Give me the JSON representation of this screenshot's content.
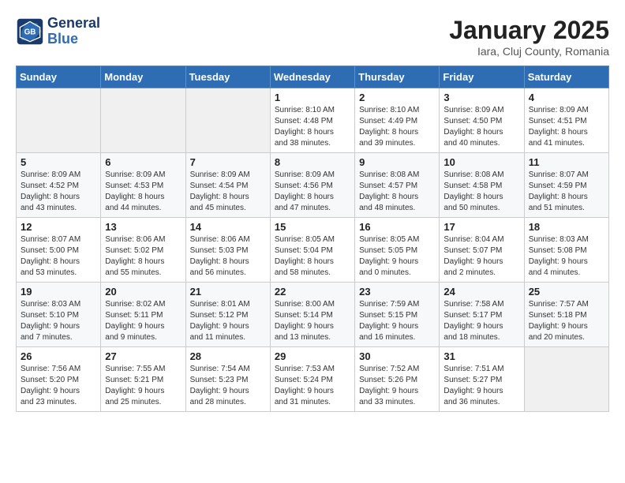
{
  "header": {
    "logo_line1": "General",
    "logo_line2": "Blue",
    "title": "January 2025",
    "subtitle": "Iara, Cluj County, Romania"
  },
  "days_of_week": [
    "Sunday",
    "Monday",
    "Tuesday",
    "Wednesday",
    "Thursday",
    "Friday",
    "Saturday"
  ],
  "weeks": [
    [
      {
        "day": "",
        "info": ""
      },
      {
        "day": "",
        "info": ""
      },
      {
        "day": "",
        "info": ""
      },
      {
        "day": "1",
        "info": "Sunrise: 8:10 AM\nSunset: 4:48 PM\nDaylight: 8 hours\nand 38 minutes."
      },
      {
        "day": "2",
        "info": "Sunrise: 8:10 AM\nSunset: 4:49 PM\nDaylight: 8 hours\nand 39 minutes."
      },
      {
        "day": "3",
        "info": "Sunrise: 8:09 AM\nSunset: 4:50 PM\nDaylight: 8 hours\nand 40 minutes."
      },
      {
        "day": "4",
        "info": "Sunrise: 8:09 AM\nSunset: 4:51 PM\nDaylight: 8 hours\nand 41 minutes."
      }
    ],
    [
      {
        "day": "5",
        "info": "Sunrise: 8:09 AM\nSunset: 4:52 PM\nDaylight: 8 hours\nand 43 minutes."
      },
      {
        "day": "6",
        "info": "Sunrise: 8:09 AM\nSunset: 4:53 PM\nDaylight: 8 hours\nand 44 minutes."
      },
      {
        "day": "7",
        "info": "Sunrise: 8:09 AM\nSunset: 4:54 PM\nDaylight: 8 hours\nand 45 minutes."
      },
      {
        "day": "8",
        "info": "Sunrise: 8:09 AM\nSunset: 4:56 PM\nDaylight: 8 hours\nand 47 minutes."
      },
      {
        "day": "9",
        "info": "Sunrise: 8:08 AM\nSunset: 4:57 PM\nDaylight: 8 hours\nand 48 minutes."
      },
      {
        "day": "10",
        "info": "Sunrise: 8:08 AM\nSunset: 4:58 PM\nDaylight: 8 hours\nand 50 minutes."
      },
      {
        "day": "11",
        "info": "Sunrise: 8:07 AM\nSunset: 4:59 PM\nDaylight: 8 hours\nand 51 minutes."
      }
    ],
    [
      {
        "day": "12",
        "info": "Sunrise: 8:07 AM\nSunset: 5:00 PM\nDaylight: 8 hours\nand 53 minutes."
      },
      {
        "day": "13",
        "info": "Sunrise: 8:06 AM\nSunset: 5:02 PM\nDaylight: 8 hours\nand 55 minutes."
      },
      {
        "day": "14",
        "info": "Sunrise: 8:06 AM\nSunset: 5:03 PM\nDaylight: 8 hours\nand 56 minutes."
      },
      {
        "day": "15",
        "info": "Sunrise: 8:05 AM\nSunset: 5:04 PM\nDaylight: 8 hours\nand 58 minutes."
      },
      {
        "day": "16",
        "info": "Sunrise: 8:05 AM\nSunset: 5:05 PM\nDaylight: 9 hours\nand 0 minutes."
      },
      {
        "day": "17",
        "info": "Sunrise: 8:04 AM\nSunset: 5:07 PM\nDaylight: 9 hours\nand 2 minutes."
      },
      {
        "day": "18",
        "info": "Sunrise: 8:03 AM\nSunset: 5:08 PM\nDaylight: 9 hours\nand 4 minutes."
      }
    ],
    [
      {
        "day": "19",
        "info": "Sunrise: 8:03 AM\nSunset: 5:10 PM\nDaylight: 9 hours\nand 7 minutes."
      },
      {
        "day": "20",
        "info": "Sunrise: 8:02 AM\nSunset: 5:11 PM\nDaylight: 9 hours\nand 9 minutes."
      },
      {
        "day": "21",
        "info": "Sunrise: 8:01 AM\nSunset: 5:12 PM\nDaylight: 9 hours\nand 11 minutes."
      },
      {
        "day": "22",
        "info": "Sunrise: 8:00 AM\nSunset: 5:14 PM\nDaylight: 9 hours\nand 13 minutes."
      },
      {
        "day": "23",
        "info": "Sunrise: 7:59 AM\nSunset: 5:15 PM\nDaylight: 9 hours\nand 16 minutes."
      },
      {
        "day": "24",
        "info": "Sunrise: 7:58 AM\nSunset: 5:17 PM\nDaylight: 9 hours\nand 18 minutes."
      },
      {
        "day": "25",
        "info": "Sunrise: 7:57 AM\nSunset: 5:18 PM\nDaylight: 9 hours\nand 20 minutes."
      }
    ],
    [
      {
        "day": "26",
        "info": "Sunrise: 7:56 AM\nSunset: 5:20 PM\nDaylight: 9 hours\nand 23 minutes."
      },
      {
        "day": "27",
        "info": "Sunrise: 7:55 AM\nSunset: 5:21 PM\nDaylight: 9 hours\nand 25 minutes."
      },
      {
        "day": "28",
        "info": "Sunrise: 7:54 AM\nSunset: 5:23 PM\nDaylight: 9 hours\nand 28 minutes."
      },
      {
        "day": "29",
        "info": "Sunrise: 7:53 AM\nSunset: 5:24 PM\nDaylight: 9 hours\nand 31 minutes."
      },
      {
        "day": "30",
        "info": "Sunrise: 7:52 AM\nSunset: 5:26 PM\nDaylight: 9 hours\nand 33 minutes."
      },
      {
        "day": "31",
        "info": "Sunrise: 7:51 AM\nSunset: 5:27 PM\nDaylight: 9 hours\nand 36 minutes."
      },
      {
        "day": "",
        "info": ""
      }
    ]
  ]
}
